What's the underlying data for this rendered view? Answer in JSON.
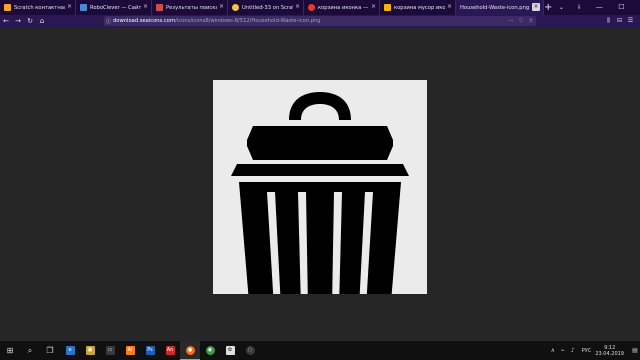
{
  "browser": {
    "tabs": [
      {
        "title": "Scratch контактная игр",
        "favicon_color": "#f6a623"
      },
      {
        "title": "RoboClever — Сайт",
        "favicon_color": "#4b8bd6"
      },
      {
        "title": "Результаты поиска - ко",
        "favicon_color": "#d44a4a"
      },
      {
        "title": "Untitled-33 on Scratch",
        "favicon_color": "#f6c343"
      },
      {
        "title": "корзина иконка — Янд",
        "favicon_color": "#e63a2e"
      },
      {
        "title": "корзина мусор иконка",
        "favicon_color": "#f5b400"
      },
      {
        "title": "Household-Waste-icon.png",
        "favicon_color": "#ffffff",
        "active": true
      }
    ],
    "close_glyph": "×",
    "new_tab_glyph": "+",
    "tab_controls": [
      "⌄",
      "⇩"
    ],
    "window_controls": [
      "—",
      "☐",
      "✕"
    ],
    "nav": {
      "back": "←",
      "forward": "→",
      "reload": "↻",
      "home": "⌂"
    },
    "url": {
      "info_glyph": "ⓘ",
      "host": "download.seaicons.com",
      "path": "/icons/icons8/windows-8/512/Household-Waste-icon.png",
      "right_icons": [
        "⋯",
        "♡",
        "☆"
      ]
    },
    "toolbar_right": [
      "⫼",
      "⊟",
      "☰"
    ]
  },
  "page": {
    "image_background": "#ebebeb",
    "icon_name": "trash-can-icon",
    "icon_color": "#000000"
  },
  "taskbar": {
    "start_glyph": "⊞",
    "search_glyph": "⌕",
    "taskview_glyph": "❐",
    "apps": [
      {
        "name": "edge",
        "label": "e",
        "color": "#2b74c9"
      },
      {
        "name": "store",
        "label": "▣",
        "color": "#c9a23a"
      },
      {
        "name": "files",
        "label": "▭",
        "color": "#3a3a3a"
      },
      {
        "name": "illustrator",
        "label": "Ai",
        "color": "#ff7b1a"
      },
      {
        "name": "photoshop",
        "label": "Ps",
        "color": "#1e5db3"
      },
      {
        "name": "animate",
        "label": "An",
        "color": "#cf2a2a"
      },
      {
        "name": "firefox",
        "label": "●",
        "color": "#ff6a1a",
        "active": true
      },
      {
        "name": "chrome",
        "label": "◉",
        "color": "#3a9a4a"
      },
      {
        "name": "scratch",
        "label": "✿",
        "color": "#e0e0e0"
      },
      {
        "name": "app",
        "label": "◌",
        "color": "#3a3a3a"
      }
    ],
    "tray_icons": [
      "∧",
      "⌁",
      "♪"
    ],
    "language": "РУС",
    "time": "9:12",
    "date": "23.04.2019",
    "notify_glyph": "▤"
  }
}
